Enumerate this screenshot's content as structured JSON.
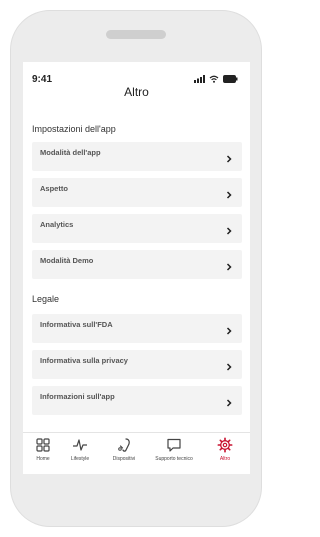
{
  "status_bar": {
    "time": "9:41"
  },
  "header": {
    "title": "Altro"
  },
  "sections": [
    {
      "title": "Impostazioni dell'app",
      "items": [
        {
          "label": "Modalità dell'app"
        },
        {
          "label": "Aspetto"
        },
        {
          "label": "Analytics"
        },
        {
          "label": "Modalità Demo"
        }
      ]
    },
    {
      "title": "Legale",
      "items": [
        {
          "label": "Informativa sull'FDA"
        },
        {
          "label": "Informativa sulla privacy"
        },
        {
          "label": "Informazioni sull'app"
        }
      ]
    }
  ],
  "tab_bar": {
    "tabs": [
      {
        "label": "Home",
        "icon": "grid-icon"
      },
      {
        "label": "Lifestyle",
        "icon": "activity-icon"
      },
      {
        "label": "Dispositivi",
        "icon": "hearing-aid-icon"
      },
      {
        "label": "Supporto tecnico",
        "icon": "chat-bubble-icon"
      },
      {
        "label": "Altro",
        "icon": "gear-icon",
        "active": true
      }
    ]
  },
  "colors": {
    "accent": "#c8102e",
    "row_background": "#f3f3f3",
    "device_frame": "#ececec"
  }
}
